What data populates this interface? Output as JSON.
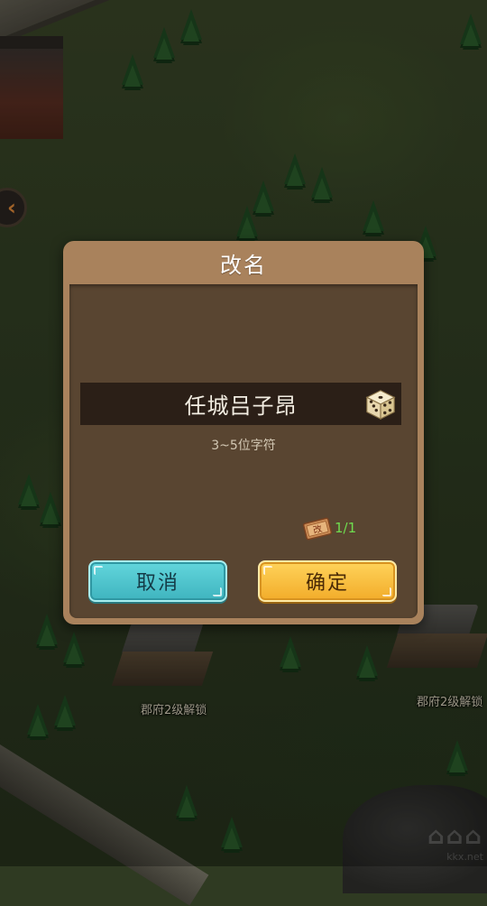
{
  "dialog": {
    "title": "改名",
    "name_value": "任城吕子昂",
    "hint": "3~5位字符",
    "ticket_glyph": "改",
    "ticket_count": "1/1",
    "cancel_label": "取消",
    "confirm_label": "确定"
  },
  "map": {
    "unlock_labels": [
      "郡府2级解锁",
      "郡府2级解锁"
    ],
    "watermark_text": "kkx.net"
  },
  "colors": {
    "dialog_frame": "#a9825c",
    "dialog_body": "#594531",
    "name_box": "#2b1f17",
    "cancel_button": "#4cc3cc",
    "confirm_button": "#f8be3c",
    "ticket_count": "#6fdc4f"
  },
  "icons": {
    "randomize": "dice-icon",
    "rename_ticket": "rename-ticket-icon",
    "side_nav": "chevron-left-icon"
  }
}
